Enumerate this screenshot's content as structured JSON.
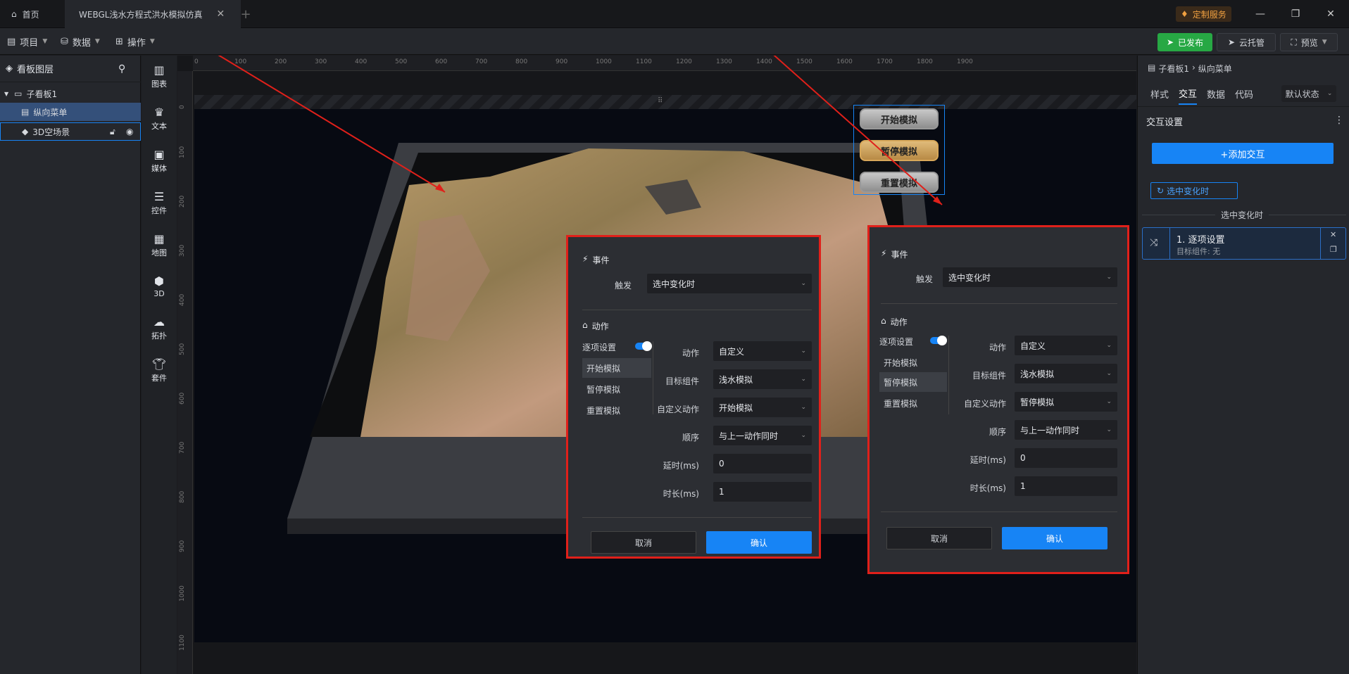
{
  "titlebar": {
    "home_label": "首页",
    "active_tab": "WEBGL浅水方程式洪水模拟仿真",
    "custom_service": "定制服务"
  },
  "menubar": {
    "project": "项目",
    "data": "数据",
    "operation": "操作",
    "published": "已发布",
    "cloud_hosting": "云托管",
    "preview": "预览"
  },
  "layers": {
    "title": "看板图层",
    "items": [
      {
        "label": "子看板1"
      },
      {
        "label": "纵向菜单"
      },
      {
        "label": "3D空场景"
      }
    ]
  },
  "iconbar": {
    "items": [
      "图表",
      "文本",
      "媒体",
      "控件",
      "地图",
      "3D",
      "拓扑",
      "套件"
    ]
  },
  "ruler": {
    "top": [
      "0",
      "100",
      "200",
      "300",
      "400",
      "500",
      "600",
      "700",
      "800",
      "900",
      "1000",
      "1100",
      "1200",
      "1300",
      "1400",
      "1500",
      "1600",
      "1700",
      "1800",
      "1900"
    ],
    "left": [
      "0",
      "100",
      "200",
      "300",
      "400",
      "500",
      "600",
      "700",
      "800",
      "900",
      "1000",
      "1100"
    ]
  },
  "menu_buttons": [
    "开始模拟",
    "暂停模拟",
    "重置模拟"
  ],
  "dialog_left": {
    "event_title": "事件",
    "trigger_label": "触发",
    "trigger_value": "选中变化时",
    "action_title": "动作",
    "toggle_label": "逐项设置",
    "list": [
      "开始模拟",
      "暂停模拟",
      "重置模拟"
    ],
    "action_label": "动作",
    "action_value": "自定义",
    "target_label": "目标组件",
    "target_value": "浅水模拟",
    "custom_label": "自定义动作",
    "custom_value": "开始模拟",
    "order_label": "顺序",
    "order_value": "与上一动作同时",
    "delay_label": "延时(ms)",
    "delay_value": "0",
    "duration_label": "时长(ms)",
    "duration_value": "1",
    "cancel": "取消",
    "ok": "确认"
  },
  "dialog_right": {
    "event_title": "事件",
    "trigger_label": "触发",
    "trigger_value": "选中变化时",
    "action_title": "动作",
    "toggle_label": "逐项设置",
    "list": [
      "开始模拟",
      "暂停模拟",
      "重置模拟"
    ],
    "action_label": "动作",
    "action_value": "自定义",
    "target_label": "目标组件",
    "target_value": "浅水模拟",
    "custom_label": "自定义动作",
    "custom_value": "暂停模拟",
    "order_label": "顺序",
    "order_value": "与上一动作同时",
    "delay_label": "延时(ms)",
    "delay_value": "0",
    "duration_label": "时长(ms)",
    "duration_value": "1",
    "cancel": "取消",
    "ok": "确认"
  },
  "rightpanel": {
    "breadcrumb_1": "子看板1",
    "breadcrumb_2": "纵向菜单",
    "tabs": [
      "样式",
      "交互",
      "数据",
      "代码"
    ],
    "state_select": "默认状态",
    "section_title": "交互设置",
    "add_interaction": "+添加交互",
    "trigger_chip": "选中变化时",
    "group_label": "选中变化时",
    "card_title": "1. 逐项设置",
    "card_sub": "目标组件: 无"
  },
  "colors": {
    "accent": "#1784f5",
    "highlight": "#e0201a",
    "published": "#27a844"
  }
}
